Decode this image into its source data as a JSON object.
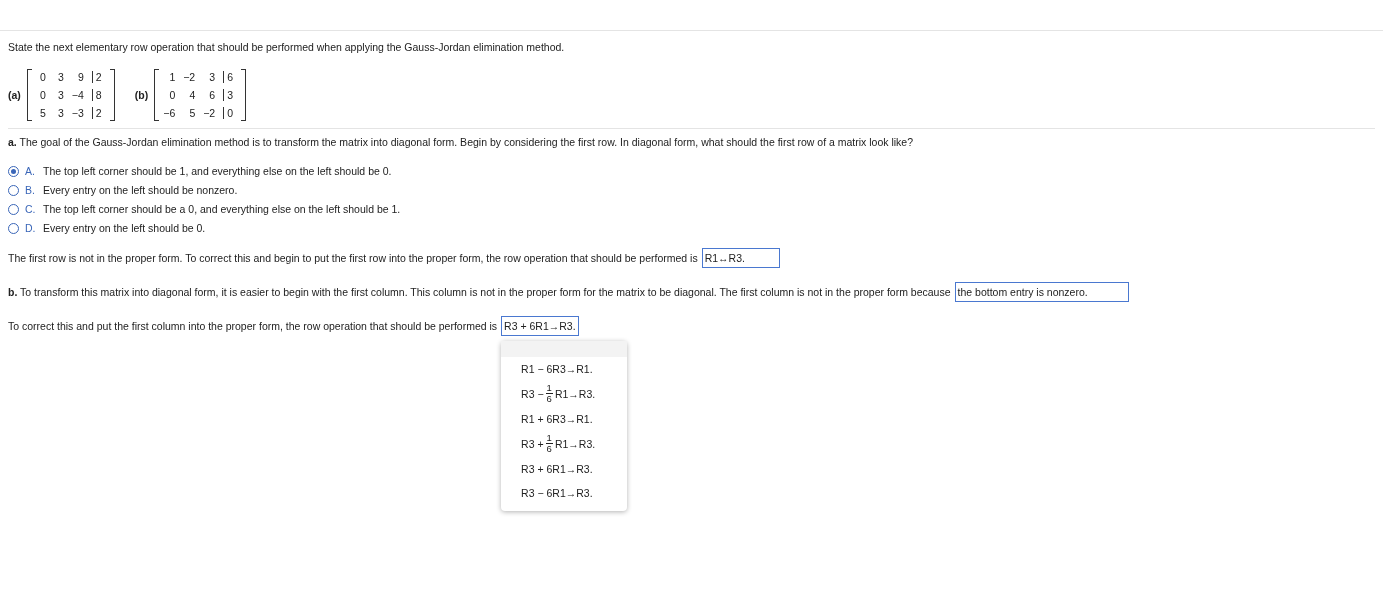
{
  "instruction": "State the next elementary row operation that should be performed when applying the Gauss-Jordan elimination method.",
  "matrices": [
    {
      "label": "(a)",
      "rows": [
        [
          "0",
          "3",
          "9",
          "2"
        ],
        [
          "0",
          "3",
          "−4",
          "8"
        ],
        [
          "5",
          "3",
          "−3",
          "2"
        ]
      ]
    },
    {
      "label": "(b)",
      "rows": [
        [
          "1",
          "−2",
          "3",
          "6"
        ],
        [
          "0",
          "4",
          "6",
          "3"
        ],
        [
          "−6",
          "5",
          "−2",
          "0"
        ]
      ]
    }
  ],
  "part_a": {
    "question": "**a.** The goal of the Gauss-Jordan elimination method is to transform the matrix into diagonal form. Begin by considering the first row. In diagonal form, what should the first row of a matrix look like?",
    "choices": [
      {
        "letter": "A.",
        "text": "The top left corner should be 1, and everything else on the left should be 0.",
        "selected": true
      },
      {
        "letter": "B.",
        "text": "Every entry on the left should be nonzero.",
        "selected": false
      },
      {
        "letter": "C.",
        "text": "The top left corner should be a 0, and everything else on the left should be 1.",
        "selected": false
      },
      {
        "letter": "D.",
        "text": "Every entry on the left should be 0.",
        "selected": false
      }
    ],
    "followup": "The first row is not in the proper form. To correct this and begin to put the first row into the proper form, the row operation that should be performed is",
    "answer": "R1↔R3."
  },
  "part_b": {
    "question": "**b.** To transform this matrix into diagonal form, it is easier to begin with the first column. This column is not in the proper form for the matrix to be diagonal. The first column is not in the proper form because",
    "answer": "the bottom entry is nonzero.",
    "followup": "To correct this and put the first column into the proper form, the row operation that should be performed is",
    "answer2": "R3 + 6R1→R3.",
    "dropdown_options": [
      {
        "kind": "plain",
        "text": "R1 − 6R3→R1."
      },
      {
        "kind": "fraction",
        "before": "R3 − ",
        "numerator": "1",
        "denominator": "6",
        "after": "R1→R3."
      },
      {
        "kind": "plain",
        "text": "R1 + 6R3→R1."
      },
      {
        "kind": "fraction",
        "before": "R3 + ",
        "numerator": "1",
        "denominator": "6",
        "after": "R1→R3."
      },
      {
        "kind": "plain",
        "text": "R3 + 6R1→R3."
      },
      {
        "kind": "plain",
        "text": "R3 − 6R1→R3."
      }
    ]
  }
}
